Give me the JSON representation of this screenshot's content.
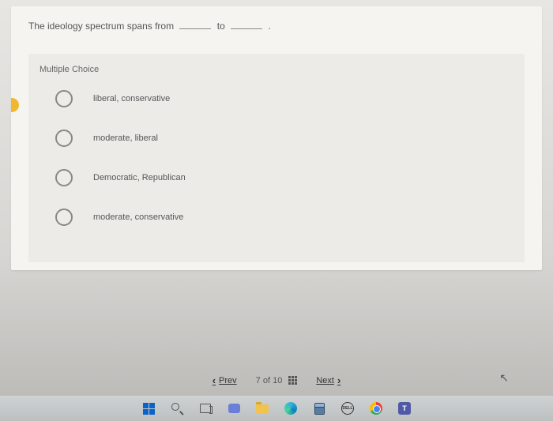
{
  "question": {
    "prefix": "The ideology spectrum spans from",
    "mid": "to",
    "suffix": "."
  },
  "mc_label": "Multiple Choice",
  "options": [
    {
      "text": "liberal, conservative"
    },
    {
      "text": "moderate, liberal"
    },
    {
      "text": "Democratic, Republican"
    },
    {
      "text": "moderate, conservative"
    }
  ],
  "nav": {
    "prev": "Prev",
    "position": "7 of 10",
    "next": "Next",
    "prev_glyph": "‹",
    "next_glyph": "›"
  },
  "taskbar": {
    "dell": "DELL",
    "teams": "T"
  }
}
